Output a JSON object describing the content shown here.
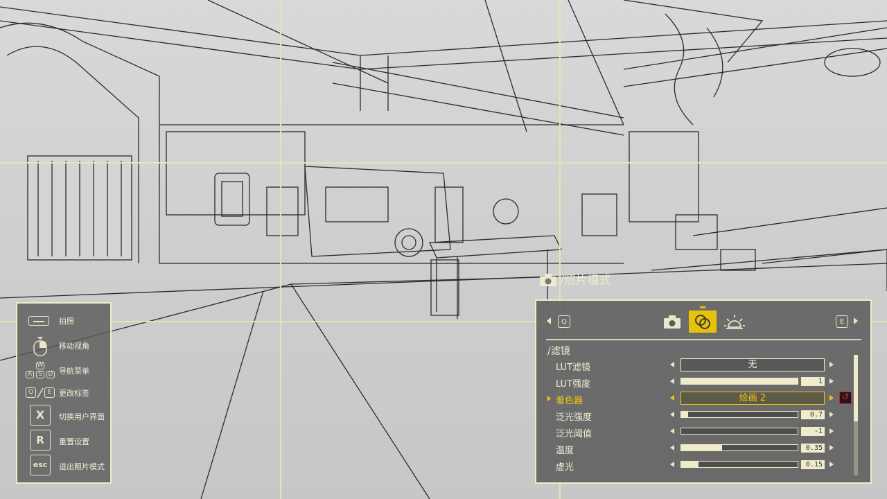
{
  "controls": [
    {
      "key": "space",
      "label": "拍照"
    },
    {
      "key": "mouse",
      "label": "移动视角"
    },
    {
      "key": "wasd",
      "keys": [
        "W",
        "A",
        "S",
        "D"
      ],
      "label": "导航菜单"
    },
    {
      "key": "qe",
      "keys": [
        "Q",
        "E"
      ],
      "label": "更改标签"
    },
    {
      "key": "X",
      "label": "切换用户界面"
    },
    {
      "key": "R",
      "label": "重置设置"
    },
    {
      "key": "esc",
      "label": "退出照片模式"
    }
  ],
  "photo_mode": {
    "title": "/照片模式"
  },
  "panel": {
    "prev_key": "Q",
    "next_key": "E",
    "tabs": [
      {
        "icon": "camera-icon",
        "active": false
      },
      {
        "icon": "filter-icon",
        "active": true
      },
      {
        "icon": "sun-icon",
        "active": false
      }
    ],
    "section_title": "/滤镜",
    "rows": [
      {
        "label": "LUT滤镜",
        "type": "select",
        "value": "无"
      },
      {
        "label": "LUT强度",
        "type": "slider",
        "value": "1",
        "level": 1.0
      },
      {
        "label": "着色器",
        "type": "select",
        "value": "绘画 2",
        "selected": true
      },
      {
        "label": "泛光强度",
        "type": "slider",
        "value": "0.7",
        "level": 0.06
      },
      {
        "label": "泛光阈值",
        "type": "slider",
        "value": "-1",
        "level": 0.0
      },
      {
        "label": "温度",
        "type": "slider",
        "value": "0.35",
        "level": 0.35
      },
      {
        "label": "虚光",
        "type": "slider",
        "value": "0.15",
        "level": 0.15
      }
    ]
  },
  "colors": {
    "accent": "#e6c20a",
    "panel_border": "#efeccc",
    "reset": "#e03030"
  }
}
